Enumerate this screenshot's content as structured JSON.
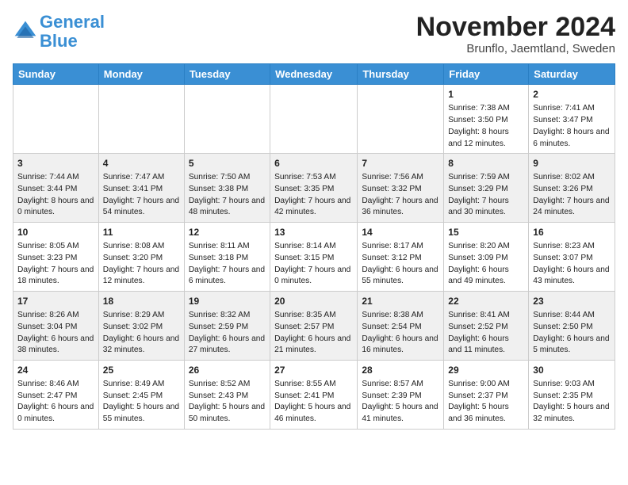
{
  "logo": {
    "line1": "General",
    "line2": "Blue"
  },
  "title": "November 2024",
  "subtitle": "Brunflo, Jaemtland, Sweden",
  "days_of_week": [
    "Sunday",
    "Monday",
    "Tuesday",
    "Wednesday",
    "Thursday",
    "Friday",
    "Saturday"
  ],
  "weeks": [
    [
      {
        "day": "",
        "info": ""
      },
      {
        "day": "",
        "info": ""
      },
      {
        "day": "",
        "info": ""
      },
      {
        "day": "",
        "info": ""
      },
      {
        "day": "",
        "info": ""
      },
      {
        "day": "1",
        "info": "Sunrise: 7:38 AM\nSunset: 3:50 PM\nDaylight: 8 hours and 12 minutes."
      },
      {
        "day": "2",
        "info": "Sunrise: 7:41 AM\nSunset: 3:47 PM\nDaylight: 8 hours and 6 minutes."
      }
    ],
    [
      {
        "day": "3",
        "info": "Sunrise: 7:44 AM\nSunset: 3:44 PM\nDaylight: 8 hours and 0 minutes."
      },
      {
        "day": "4",
        "info": "Sunrise: 7:47 AM\nSunset: 3:41 PM\nDaylight: 7 hours and 54 minutes."
      },
      {
        "day": "5",
        "info": "Sunrise: 7:50 AM\nSunset: 3:38 PM\nDaylight: 7 hours and 48 minutes."
      },
      {
        "day": "6",
        "info": "Sunrise: 7:53 AM\nSunset: 3:35 PM\nDaylight: 7 hours and 42 minutes."
      },
      {
        "day": "7",
        "info": "Sunrise: 7:56 AM\nSunset: 3:32 PM\nDaylight: 7 hours and 36 minutes."
      },
      {
        "day": "8",
        "info": "Sunrise: 7:59 AM\nSunset: 3:29 PM\nDaylight: 7 hours and 30 minutes."
      },
      {
        "day": "9",
        "info": "Sunrise: 8:02 AM\nSunset: 3:26 PM\nDaylight: 7 hours and 24 minutes."
      }
    ],
    [
      {
        "day": "10",
        "info": "Sunrise: 8:05 AM\nSunset: 3:23 PM\nDaylight: 7 hours and 18 minutes."
      },
      {
        "day": "11",
        "info": "Sunrise: 8:08 AM\nSunset: 3:20 PM\nDaylight: 7 hours and 12 minutes."
      },
      {
        "day": "12",
        "info": "Sunrise: 8:11 AM\nSunset: 3:18 PM\nDaylight: 7 hours and 6 minutes."
      },
      {
        "day": "13",
        "info": "Sunrise: 8:14 AM\nSunset: 3:15 PM\nDaylight: 7 hours and 0 minutes."
      },
      {
        "day": "14",
        "info": "Sunrise: 8:17 AM\nSunset: 3:12 PM\nDaylight: 6 hours and 55 minutes."
      },
      {
        "day": "15",
        "info": "Sunrise: 8:20 AM\nSunset: 3:09 PM\nDaylight: 6 hours and 49 minutes."
      },
      {
        "day": "16",
        "info": "Sunrise: 8:23 AM\nSunset: 3:07 PM\nDaylight: 6 hours and 43 minutes."
      }
    ],
    [
      {
        "day": "17",
        "info": "Sunrise: 8:26 AM\nSunset: 3:04 PM\nDaylight: 6 hours and 38 minutes."
      },
      {
        "day": "18",
        "info": "Sunrise: 8:29 AM\nSunset: 3:02 PM\nDaylight: 6 hours and 32 minutes."
      },
      {
        "day": "19",
        "info": "Sunrise: 8:32 AM\nSunset: 2:59 PM\nDaylight: 6 hours and 27 minutes."
      },
      {
        "day": "20",
        "info": "Sunrise: 8:35 AM\nSunset: 2:57 PM\nDaylight: 6 hours and 21 minutes."
      },
      {
        "day": "21",
        "info": "Sunrise: 8:38 AM\nSunset: 2:54 PM\nDaylight: 6 hours and 16 minutes."
      },
      {
        "day": "22",
        "info": "Sunrise: 8:41 AM\nSunset: 2:52 PM\nDaylight: 6 hours and 11 minutes."
      },
      {
        "day": "23",
        "info": "Sunrise: 8:44 AM\nSunset: 2:50 PM\nDaylight: 6 hours and 5 minutes."
      }
    ],
    [
      {
        "day": "24",
        "info": "Sunrise: 8:46 AM\nSunset: 2:47 PM\nDaylight: 6 hours and 0 minutes."
      },
      {
        "day": "25",
        "info": "Sunrise: 8:49 AM\nSunset: 2:45 PM\nDaylight: 5 hours and 55 minutes."
      },
      {
        "day": "26",
        "info": "Sunrise: 8:52 AM\nSunset: 2:43 PM\nDaylight: 5 hours and 50 minutes."
      },
      {
        "day": "27",
        "info": "Sunrise: 8:55 AM\nSunset: 2:41 PM\nDaylight: 5 hours and 46 minutes."
      },
      {
        "day": "28",
        "info": "Sunrise: 8:57 AM\nSunset: 2:39 PM\nDaylight: 5 hours and 41 minutes."
      },
      {
        "day": "29",
        "info": "Sunrise: 9:00 AM\nSunset: 2:37 PM\nDaylight: 5 hours and 36 minutes."
      },
      {
        "day": "30",
        "info": "Sunrise: 9:03 AM\nSunset: 2:35 PM\nDaylight: 5 hours and 32 minutes."
      }
    ]
  ]
}
